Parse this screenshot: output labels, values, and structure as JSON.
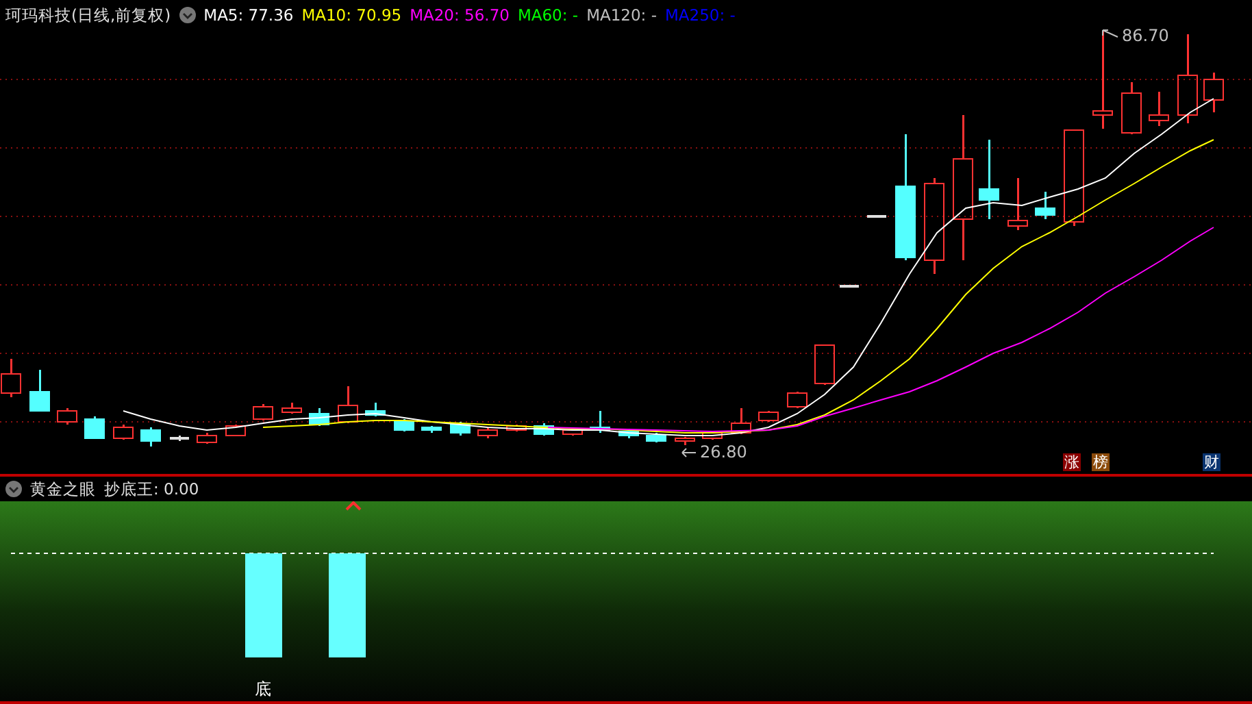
{
  "legend": {
    "name": "珂玛科技",
    "mode": "(日线,前复权)",
    "averages": [
      {
        "text": "MA5: 77.36",
        "color": "#ffffff"
      },
      {
        "text": "MA10: 70.95",
        "color": "#ffff00"
      },
      {
        "text": "MA20: 56.70",
        "color": "#ff00ff"
      },
      {
        "text": "MA60: -",
        "color": "#00ff00"
      },
      {
        "text": "MA120: -",
        "color": "#c0c0c0"
      },
      {
        "text": "MA250: -",
        "color": "#0000ff"
      }
    ]
  },
  "price_chart": {
    "high_label": "86.70",
    "low_label": "26.80",
    "badges": [
      {
        "text": "涨",
        "color": "#8b0000"
      },
      {
        "text": "榜",
        "color": "#8b4a0a"
      },
      {
        "text": "财",
        "color": "#0a3470"
      }
    ]
  },
  "indicator": {
    "name": "黄金之眼",
    "reading": "抄底王: 0.00",
    "signal": "底"
  }
}
